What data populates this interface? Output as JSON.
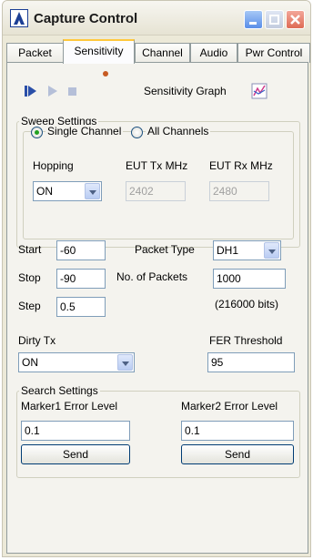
{
  "window": {
    "title": "Capture Control"
  },
  "tabs": [
    {
      "label": "Packet"
    },
    {
      "label": "Sensitivity"
    },
    {
      "label": "Channel"
    },
    {
      "label": "Audio"
    },
    {
      "label": "Pwr Control"
    }
  ],
  "toolbar": {
    "graph_label": "Sensitivity Graph"
  },
  "sweep": {
    "title": "Sweep Settings",
    "single_channel": "Single Channel",
    "all_channels": "All Channels",
    "selected_mode": "Single Channel",
    "hopping_label": "Hopping",
    "hopping_value": "ON",
    "eut_tx_label": "EUT Tx MHz",
    "eut_tx_value": "2402",
    "eut_rx_label": "EUT Rx MHz",
    "eut_rx_value": "2480"
  },
  "params": {
    "start_label": "Start",
    "start_value": "-60",
    "stop_label": "Stop",
    "stop_value": "-90",
    "step_label": "Step",
    "step_value": "0.5",
    "packet_type_label": "Packet Type",
    "packet_type_value": "DH1",
    "num_packets_label": "No. of Packets",
    "num_packets_value": "1000",
    "bits_note": "(216000 bits)",
    "dirty_tx_label": "Dirty Tx",
    "dirty_tx_value": "ON",
    "fer_label": "FER Threshold",
    "fer_value": "95"
  },
  "search": {
    "title": "Search Settings",
    "marker1_label": "Marker1 Error Level",
    "marker1_value": "0.1",
    "send1": "Send",
    "marker2_label": "Marker2 Error Level",
    "marker2_value": "0.1",
    "send2": "Send"
  },
  "colors": {
    "accent": "#1c3f95",
    "tab_highlight": "#ffc83c",
    "window_bg": "#ece9d8"
  }
}
